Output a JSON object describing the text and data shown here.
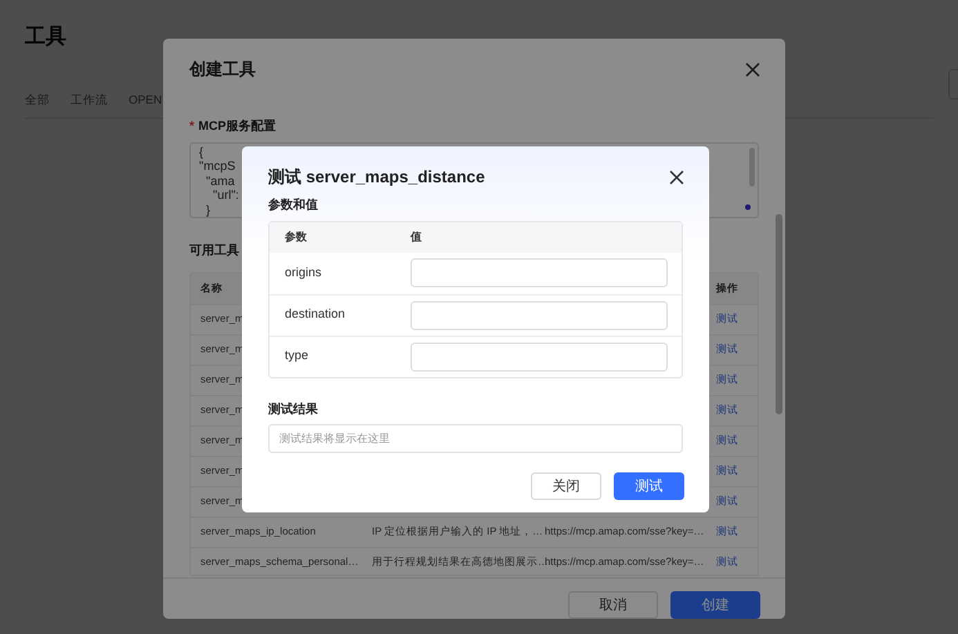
{
  "page": {
    "title": "工具",
    "tabs": [
      "全部",
      "工作流",
      "OPEN"
    ]
  },
  "create_dialog": {
    "title": "创建工具",
    "config_label": "MCP服务配置",
    "required_mark": "*",
    "config_lines": [
      "{",
      "\"mcpS",
      "  \"ama",
      "    \"url\":",
      "  }"
    ],
    "tools_label": "可用工具",
    "columns": {
      "name": "名称",
      "action": "操作"
    },
    "rows": [
      {
        "name": "server_m",
        "action": "测试"
      },
      {
        "name": "server_m",
        "action": "测试"
      },
      {
        "name": "server_m",
        "action": "测试"
      },
      {
        "name": "server_m",
        "action": "测试"
      },
      {
        "name": "server_m",
        "action": "测试"
      },
      {
        "name": "server_m",
        "action": "测试"
      },
      {
        "name": "server_m",
        "action": "测试"
      },
      {
        "name": "server_maps_ip_location",
        "description": "IP 定位根据用户输入的 IP 地址，…",
        "url": "https://mcp.amap.com/sse?key=…",
        "action": "测试"
      },
      {
        "name": "server_maps_schema_personal…",
        "description": "用于行程规划结果在高德地图展示…",
        "url": "https://mcp.amap.com/sse?key=…",
        "action": "测试"
      }
    ],
    "buttons": [
      {
        "label": "取消",
        "kind": "secondary"
      },
      {
        "label": "创建",
        "kind": "primary"
      }
    ]
  },
  "test_dialog": {
    "title": "测试 server_maps_distance",
    "params_label": "参数和值",
    "columns": [
      "参数",
      "值"
    ],
    "params": [
      {
        "name": "origins"
      },
      {
        "name": "destination"
      },
      {
        "name": "type"
      }
    ],
    "result_label": "测试结果",
    "result_placeholder": "测试结果将显示在这里",
    "buttons": [
      {
        "label": "关闭",
        "kind": "secondary"
      },
      {
        "label": "测试",
        "kind": "primary"
      }
    ]
  }
}
